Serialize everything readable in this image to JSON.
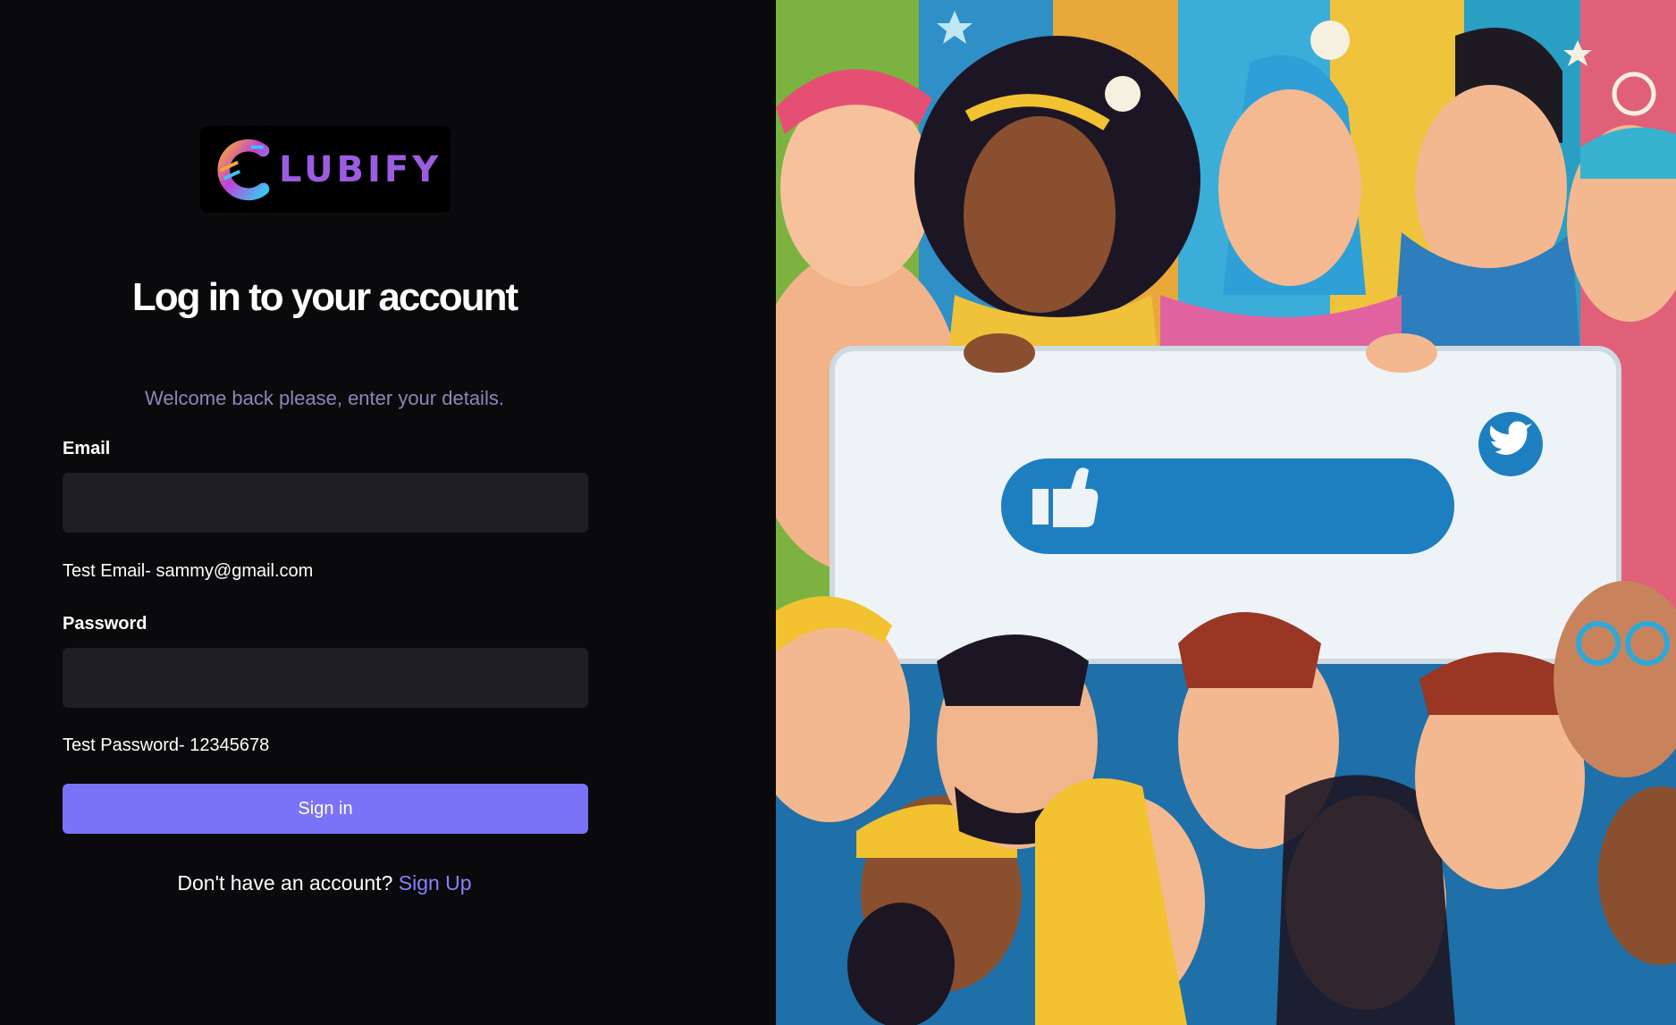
{
  "brand": {
    "logo_text": "LUBIFY"
  },
  "login": {
    "title": "Log in to your account",
    "subtitle": "Welcome back please, enter your details.",
    "email_label": "Email",
    "email_value": "",
    "email_hint": "Test Email- sammy@gmail.com",
    "password_label": "Password",
    "password_value": "",
    "password_hint": "Test Password- 12345678",
    "signin_label": "Sign in",
    "signup_prompt": "Don't have an account?",
    "signup_link": "Sign Up"
  },
  "illustration": {
    "icons": [
      "thumbs-up-icon",
      "twitter-icon"
    ]
  },
  "colors": {
    "background": "#0a0a0d",
    "input_bg": "#1f1f23",
    "accent": "#7b73f7",
    "link": "#8b80ff",
    "subtitle": "#8c86b8",
    "logo_text": "#9a5de0"
  }
}
